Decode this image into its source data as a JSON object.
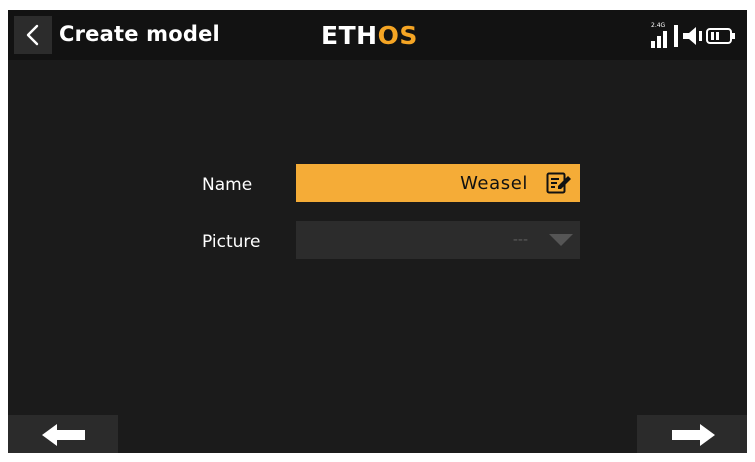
{
  "header": {
    "title": "Create model",
    "logo_part1": "ETH",
    "logo_part2": "OS",
    "band_label": "2.4G"
  },
  "form": {
    "name_label": "Name",
    "name_value": "Weasel",
    "picture_label": "Picture",
    "picture_value": "---"
  },
  "icons": {
    "back": "chevron-left-icon",
    "signal": "signal-bars-icon",
    "volume": "speaker-icon",
    "battery": "battery-icon",
    "edit": "edit-icon",
    "dropdown": "triangle-down-icon",
    "previous": "arrow-left-icon",
    "next": "arrow-right-icon"
  },
  "colors": {
    "accent": "#f5ac37",
    "background": "#1b1b1b",
    "header": "#121212",
    "field": "#2c2c2c"
  }
}
